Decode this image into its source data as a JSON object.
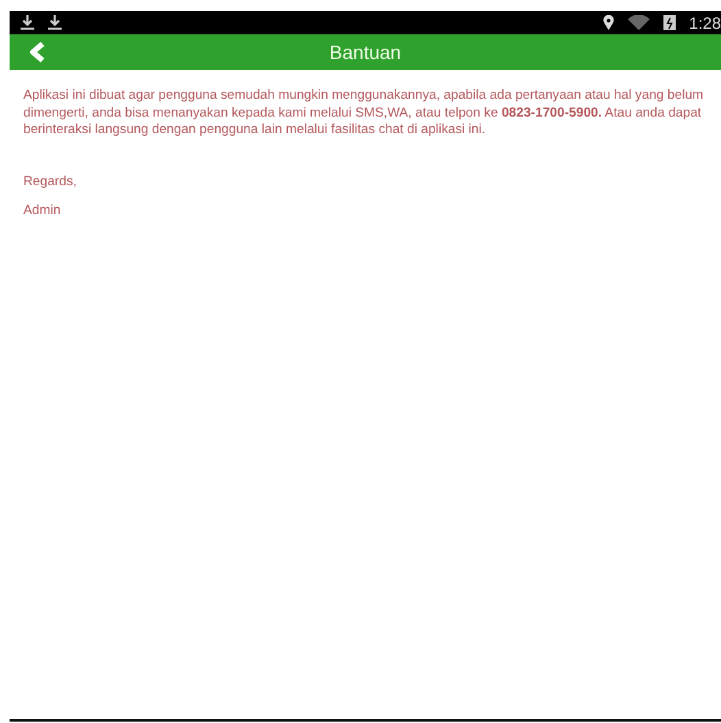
{
  "status_bar": {
    "time": "1:28"
  },
  "app_bar": {
    "title": "Bantuan"
  },
  "content": {
    "paragraph": "Aplikasi ini dibuat agar pengguna semudah mungkin menggunakannya, apabila ada pertanyaan atau hal yang belum dimengerti, anda bisa menanyakan kepada kami melalui SMS,WA, atau telpon ke **0823-1700-5900.** Atau anda dapat berinteraksi langsung dengan pengguna lain melalui fasilitas chat di aplikasi ini.",
    "closing": "Regards,",
    "signature": "Admin"
  }
}
